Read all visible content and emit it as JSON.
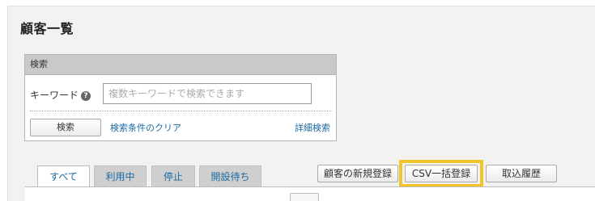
{
  "page": {
    "title": "顧客一覧"
  },
  "search": {
    "header": "検索",
    "keyword_label": "キーワード",
    "keyword_placeholder": "複数キーワードで検索できます",
    "keyword_value": "",
    "search_button": "検索",
    "clear_link": "検索条件のクリア",
    "advanced_link": "詳細検索"
  },
  "tabs": [
    {
      "label": "すべて",
      "active": true
    },
    {
      "label": "利用中",
      "active": false
    },
    {
      "label": "停止",
      "active": false
    },
    {
      "label": "開設待ち",
      "active": false
    }
  ],
  "actions": {
    "new_customer": "顧客の新規登録",
    "csv_import": "CSV一括登録",
    "import_history": "取込履歴"
  },
  "colors": {
    "highlight": "#f2c52b",
    "link": "#1c6aa3",
    "panel_bg": "#f2f2f2"
  }
}
